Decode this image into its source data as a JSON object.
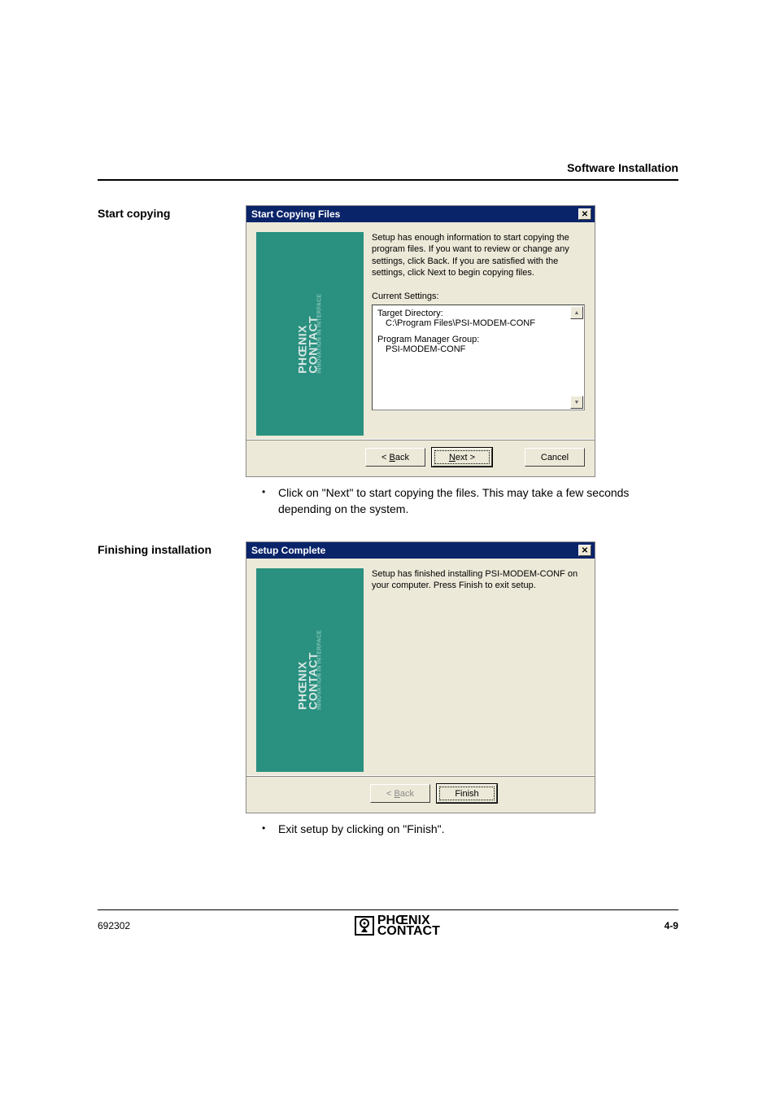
{
  "page_header": "Software Installation",
  "sections": {
    "start_copying": {
      "side_label": "Start copying",
      "dialog": {
        "title": "Start Copying Files",
        "side_brand": {
          "line1": "PHŒNIX",
          "line2": "CONTACT",
          "tag": "INNOVATION IN INTERFACE"
        },
        "instruction": "Setup has enough information to start copying the program files. If you want to review or change any settings, click Back. If you are satisfied with the settings, click Next to begin copying files.",
        "current_label": "Current Settings:",
        "target_dir_label": "Target Directory:",
        "target_dir_value": "C:\\Program Files\\PSI-MODEM-CONF",
        "pm_group_label": "Program Manager Group:",
        "pm_group_value": "PSI-MODEM-CONF",
        "buttons": {
          "back": "< Back",
          "next": "Next >",
          "cancel": "Cancel"
        }
      },
      "bullet": "Click on \"Next\" to start copying the files. This may take a few seconds depending on the system."
    },
    "finishing": {
      "side_label": "Finishing installation",
      "dialog": {
        "title": "Setup Complete",
        "side_brand": {
          "line1": "PHŒNIX",
          "line2": "CONTACT",
          "tag": "INNOVATION IN INTERFACE"
        },
        "instruction": "Setup has finished installing PSI-MODEM-CONF on your computer. Press Finish to exit setup.",
        "buttons": {
          "back": "< Back",
          "finish": "Finish"
        }
      },
      "bullet": "Exit setup by clicking on \"Finish\"."
    }
  },
  "footer": {
    "left": "692302",
    "logo": {
      "line1": "PHŒNIX",
      "line2": "CONTACT"
    },
    "right": "4-9"
  }
}
